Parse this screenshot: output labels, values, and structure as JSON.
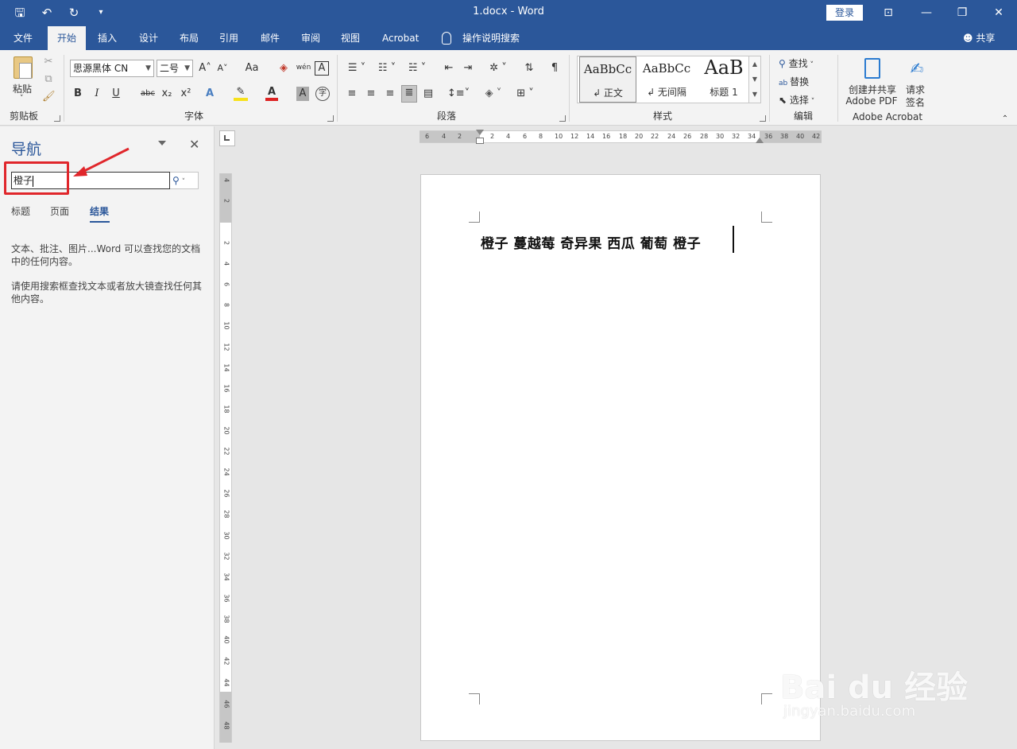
{
  "titlebar": {
    "title": "1.docx  -  Word",
    "login": "登录",
    "qat": {
      "save_glyph": "🖫",
      "undo_glyph": "↶",
      "redo_glyph": "↻",
      "more_glyph": "▾"
    },
    "win": {
      "ribbon_opts": "⊡",
      "minimize": "—",
      "restore": "❐",
      "close": "✕"
    }
  },
  "tabs": {
    "items": [
      "文件",
      "开始",
      "插入",
      "设计",
      "布局",
      "引用",
      "邮件",
      "审阅",
      "视图",
      "Acrobat"
    ],
    "tell_me": "操作说明搜索",
    "share": "共享",
    "active": "开始"
  },
  "ribbon": {
    "clipboard": {
      "label": "剪贴板",
      "paste": "粘贴"
    },
    "font": {
      "label": "字体",
      "family": "思源黑体 CN",
      "size": "二号",
      "bold": "B",
      "italic": "I",
      "underline": "U",
      "strike": "abc",
      "sub": "x₂",
      "sup": "x²",
      "grow": "A˄",
      "shrink": "A˅",
      "case": "Aa",
      "phonetic": "wén",
      "border_char": "A",
      "color": "A",
      "shade": "A",
      "enclose": "字"
    },
    "paragraph": {
      "label": "段落"
    },
    "styles": {
      "label": "样式",
      "items": [
        {
          "sample": "AaBbCc",
          "name": "↲ 正文"
        },
        {
          "sample": "AaBbCc",
          "name": "↲ 无间隔"
        },
        {
          "sample": "AaB",
          "name": "标题 1"
        }
      ]
    },
    "editing": {
      "label": "编辑",
      "find": "查找",
      "replace": "替换",
      "select": "选择"
    },
    "acrobat": {
      "label": "Adobe Acrobat",
      "create_line1": "创建并共享",
      "create_line2": "Adobe PDF",
      "sign_line1": "请求",
      "sign_line2": "签名"
    }
  },
  "nav": {
    "title": "导航",
    "search_value": "橙子",
    "tabs": [
      "标题",
      "页面",
      "结果"
    ],
    "active_tab": "结果",
    "msg1": "文本、批注、图片...Word 可以查找您的文档中的任何内容。",
    "msg2": "请使用搜索框查找文本或者放大镜查找任何其他内容。"
  },
  "ruler": {
    "h_ticks": [
      "6",
      "4",
      "2",
      "2",
      "4",
      "6",
      "8",
      "10",
      "12",
      "14",
      "16",
      "18",
      "20",
      "22",
      "24",
      "26",
      "28",
      "30",
      "32",
      "34",
      "36",
      "38",
      "40",
      "42"
    ],
    "v_ticks": [
      "4",
      "2",
      "2",
      "4",
      "6",
      "8",
      "10",
      "12",
      "14",
      "16",
      "18",
      "20",
      "22",
      "24",
      "26",
      "28",
      "30",
      "32",
      "34",
      "36",
      "38",
      "40",
      "42",
      "44",
      "46",
      "48"
    ]
  },
  "document": {
    "text": "橙子  蔓越莓  奇异果  西瓜  葡萄  橙子"
  },
  "watermark": {
    "main": "Bai du 经验",
    "sub": "jingyan.baidu.com"
  },
  "colors": {
    "accent": "#2b579a",
    "annotation": "#e0262b"
  }
}
